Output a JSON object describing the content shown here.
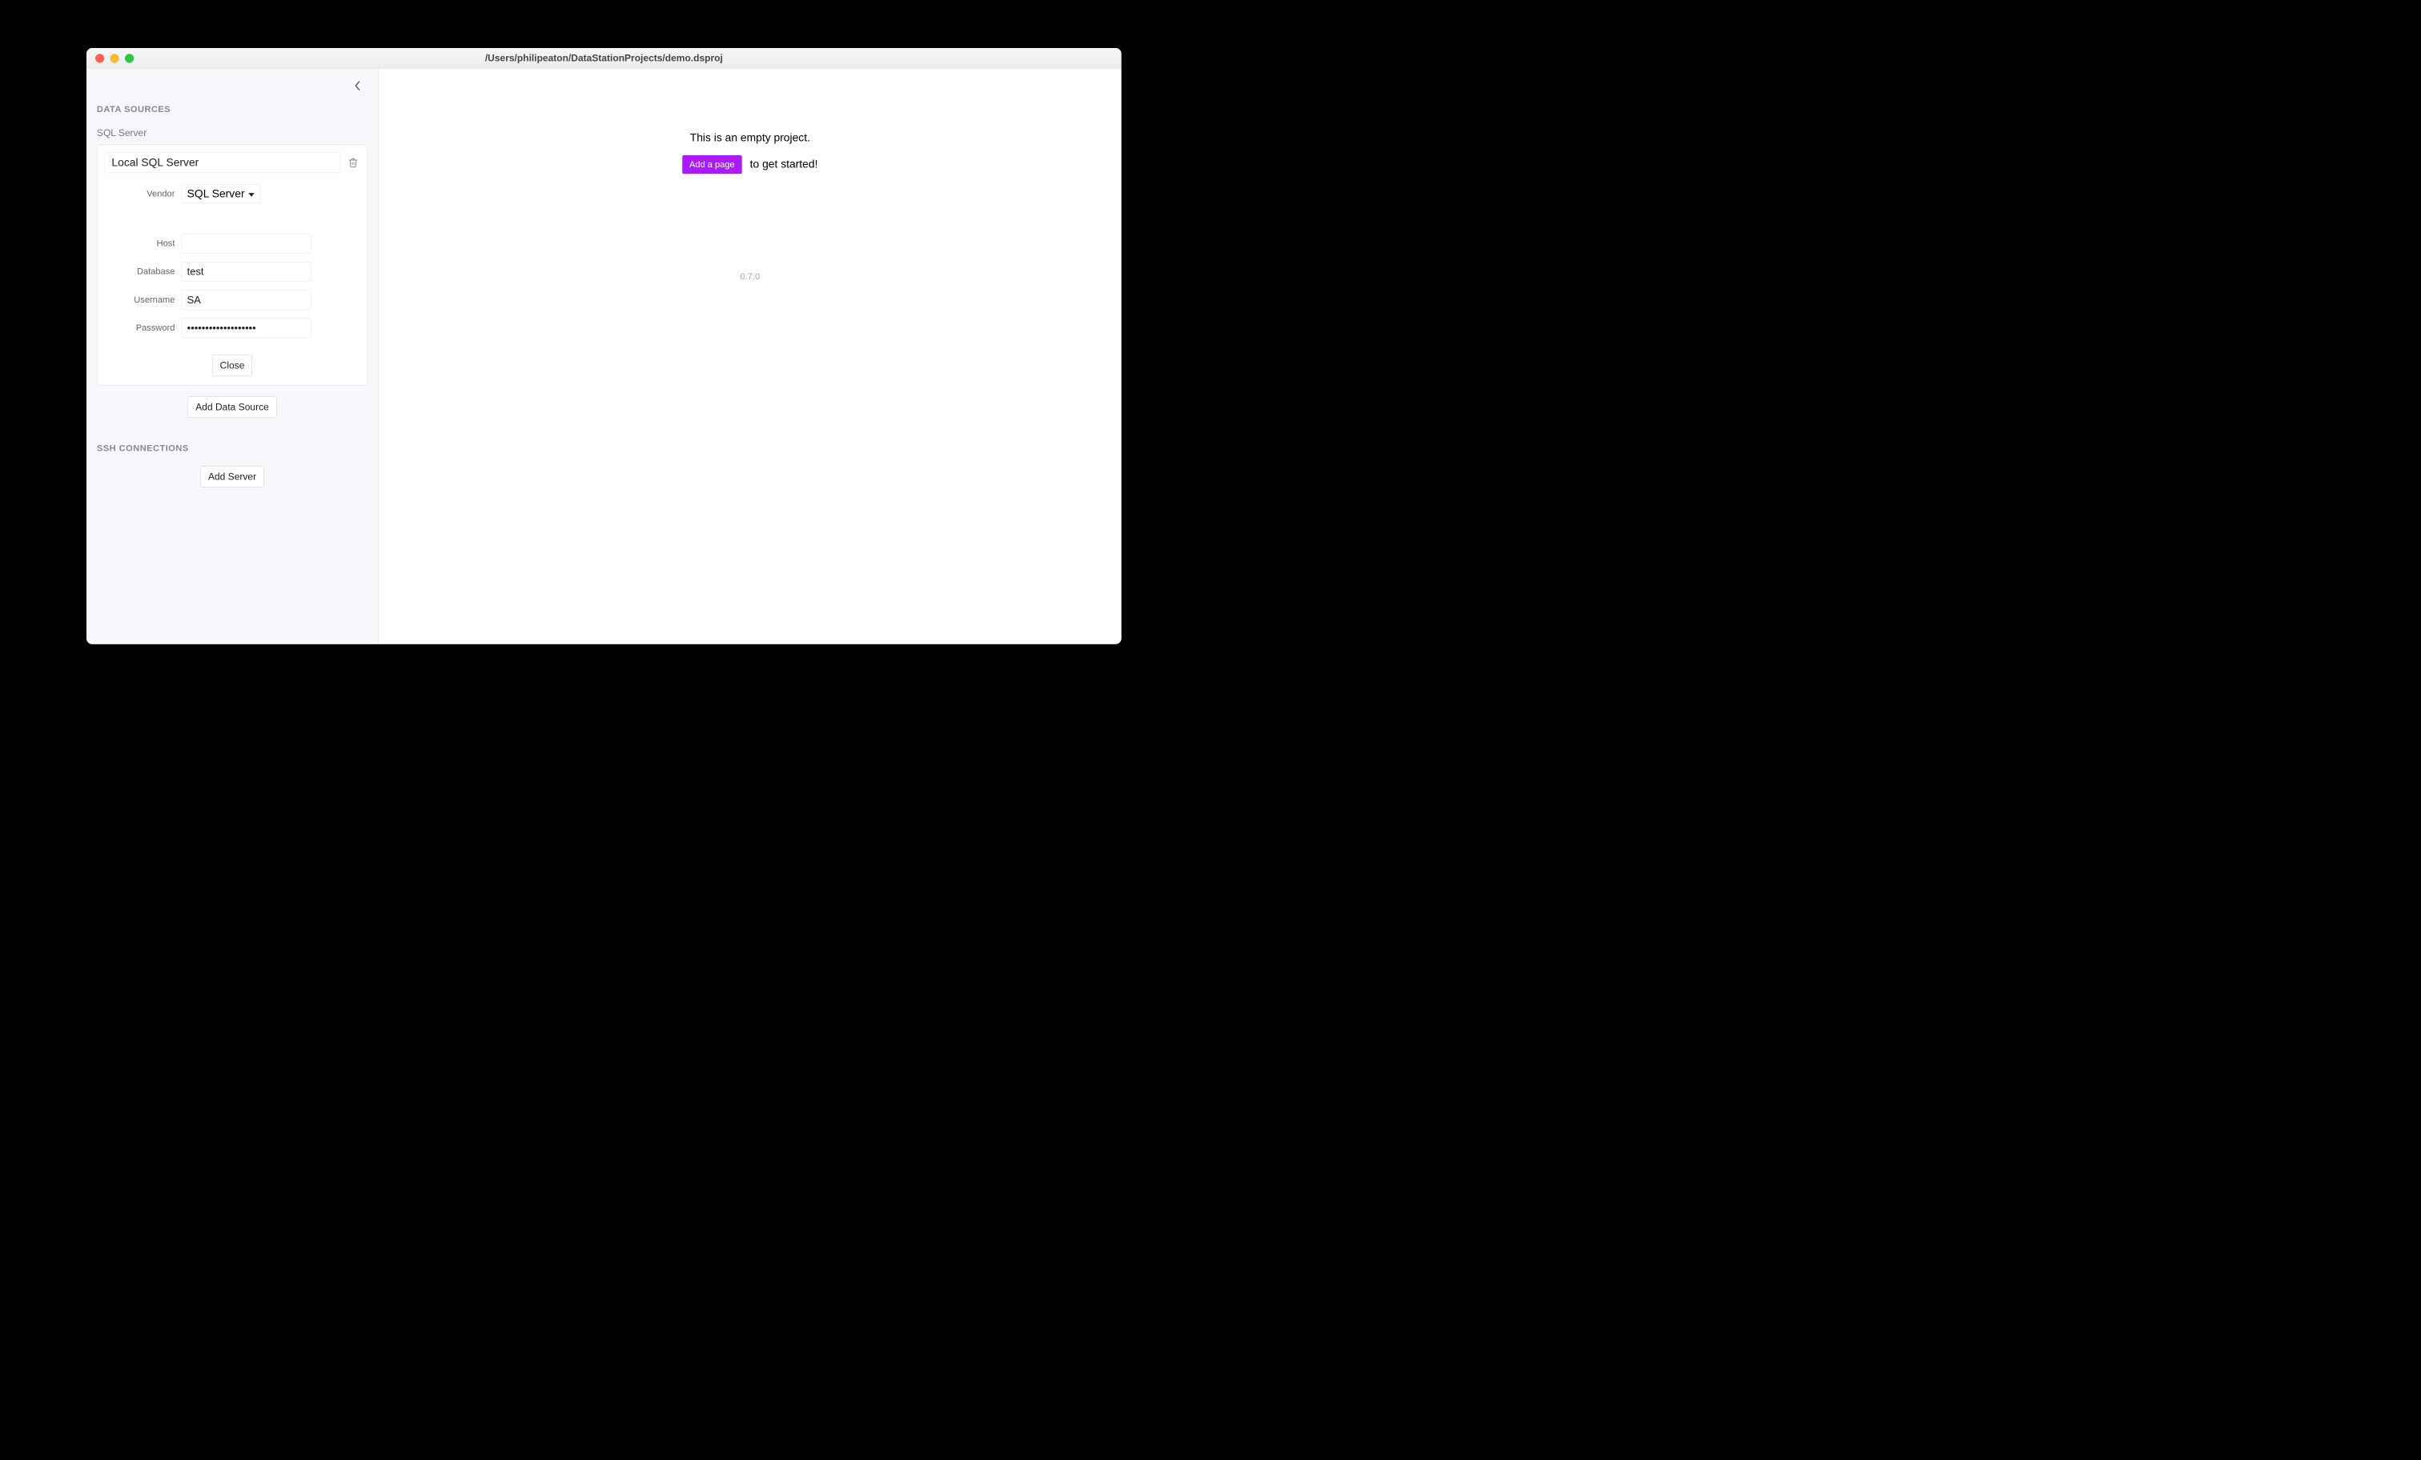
{
  "window": {
    "title": "/Users/philipeaton/DataStationProjects/demo.dsproj"
  },
  "sidebar": {
    "sections": {
      "data_sources_title": "DATA SOURCES",
      "ssh_title": "SSH CONNECTIONS"
    },
    "data_source": {
      "type_label": "SQL Server",
      "name_value": "Local SQL Server",
      "fields": {
        "vendor": {
          "label": "Vendor",
          "value": "SQL Server"
        },
        "host": {
          "label": "Host",
          "value": ""
        },
        "database": {
          "label": "Database",
          "value": "test"
        },
        "username": {
          "label": "Username",
          "value": "SA"
        },
        "password": {
          "label": "Password",
          "value": "•••••••••••••••••••"
        }
      },
      "close_label": "Close"
    },
    "add_data_source_label": "Add Data Source",
    "add_server_label": "Add Server"
  },
  "main": {
    "empty_project_text": "This is an empty project.",
    "add_page_label": "Add a page",
    "get_started_text": "to get started!",
    "version": "0.7.0"
  }
}
